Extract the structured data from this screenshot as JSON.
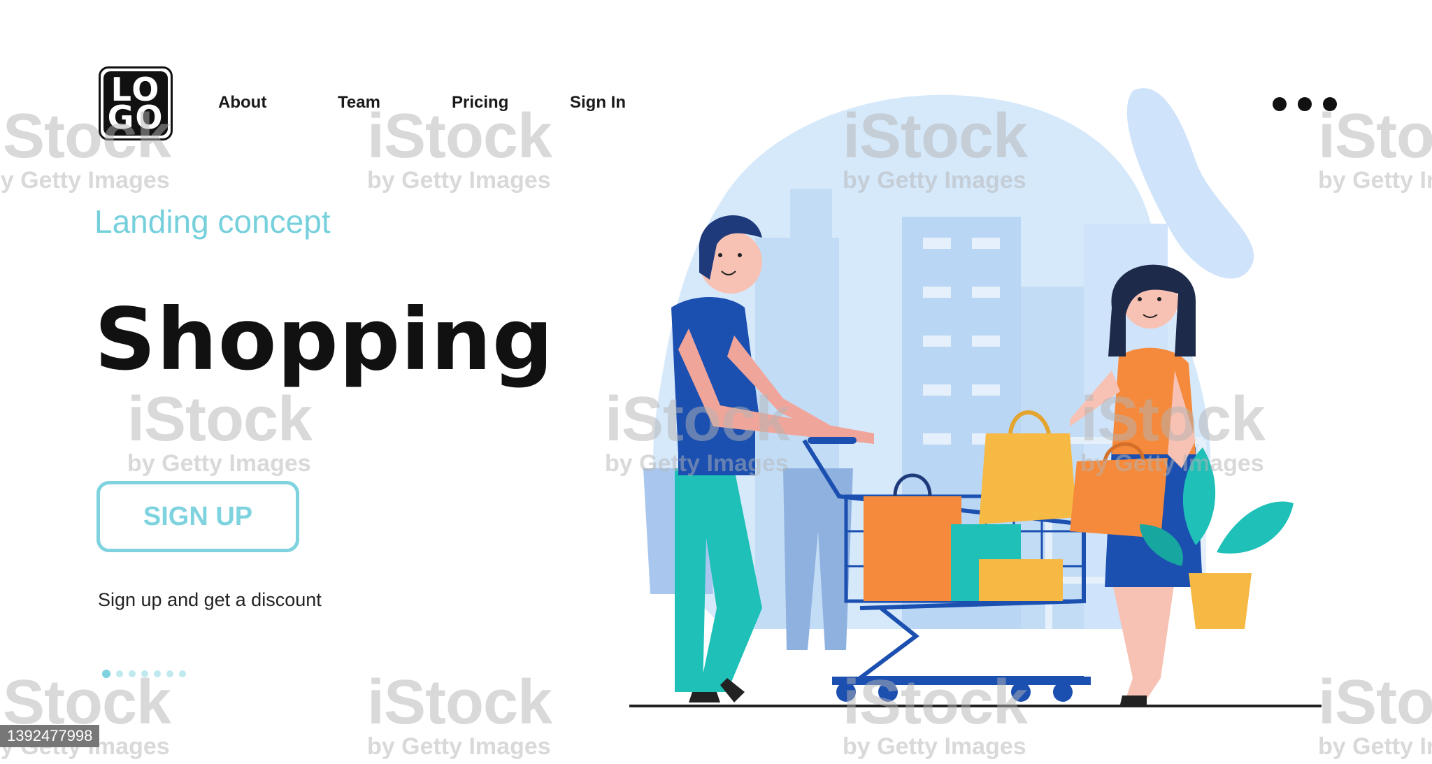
{
  "logo": {
    "line1": "LO",
    "line2": "GO"
  },
  "nav": {
    "items": [
      "About",
      "Team",
      "Pricing",
      "Sign In"
    ]
  },
  "hero": {
    "subtitle": "Landing concept",
    "title": "Shopping",
    "button_label": "SIGN UP",
    "tagline": "Sign up and get a discount"
  },
  "pagination": {
    "count": 7,
    "active": 0
  },
  "watermark": {
    "brand": "iStock",
    "credit": "by Getty Images",
    "image_id": "1392477998"
  },
  "colors": {
    "accent": "#7ed3df",
    "shirt": "#1b4fb0",
    "pants": "#1ec0b8",
    "bag_orange": "#f58a3c",
    "bag_yellow": "#f6b944",
    "bg_blob": "#d6e9fb"
  },
  "icons": [
    "more-dots-icon"
  ]
}
